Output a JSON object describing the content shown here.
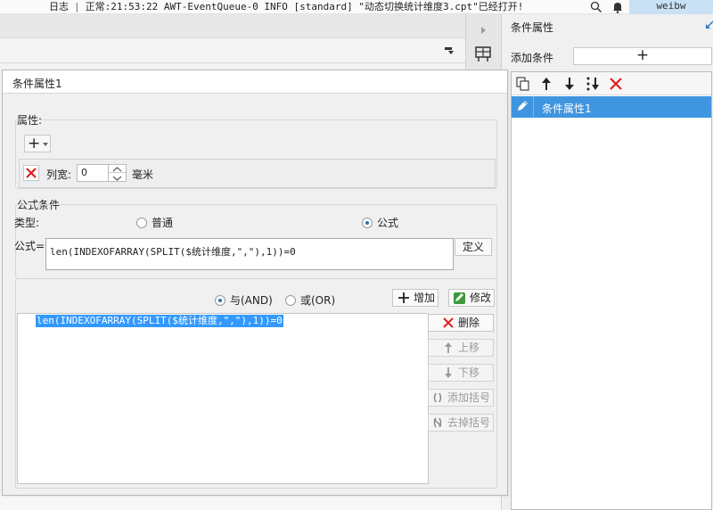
{
  "topbar": {
    "log_label": "日志",
    "status_text": "正常:21:53:22 AWT-EventQueue-0 INFO [standard] \"动态切换统计维度3.cpt\"已经打开!",
    "user": "weibw",
    "icons": [
      "search-icon",
      "bell-icon"
    ]
  },
  "right_panel": {
    "title": "条件属性",
    "add_condition_label": "添加条件",
    "add_button_symbol": "+",
    "toolbar_icons": [
      "copy-icon",
      "move-up-icon",
      "move-down-icon",
      "sort-icon",
      "delete-icon"
    ],
    "items": [
      {
        "label": "条件属性1",
        "selected": true
      }
    ]
  },
  "dialog": {
    "tab_title": "条件属性1",
    "property_section": {
      "title": "属性:",
      "add_symbol": "+",
      "row": {
        "label": "列宽:",
        "value": "0",
        "unit": "毫米"
      }
    },
    "formula_section": {
      "title": "公式条件",
      "type_label": "类型:",
      "type_options": [
        {
          "label": "普通",
          "checked": false
        },
        {
          "label": "公式",
          "checked": true
        }
      ],
      "formula_label": "公式=",
      "formula_value": "len(INDEXOFARRAY(SPLIT($统计维度,\",\"),1))=0",
      "define_button": "定义"
    },
    "logic": {
      "and_label": "与(AND)",
      "or_label": "或(OR)",
      "and_checked": true,
      "add_button": "增加",
      "modify_button": "修改"
    },
    "condition_list": {
      "items": [
        "len(INDEXOFARRAY(SPLIT($统计维度,\",\"),1))=0"
      ]
    },
    "side_buttons": {
      "delete": "删除",
      "move_up": "上移",
      "move_down": "下移",
      "add_bracket": "添加括号",
      "remove_bracket": "去掉括号"
    }
  },
  "colors": {
    "selection": "#3399ff",
    "list_selected": "#3f95df",
    "delete_red": "#e02020",
    "radio_dot": "#2b6fb3"
  }
}
